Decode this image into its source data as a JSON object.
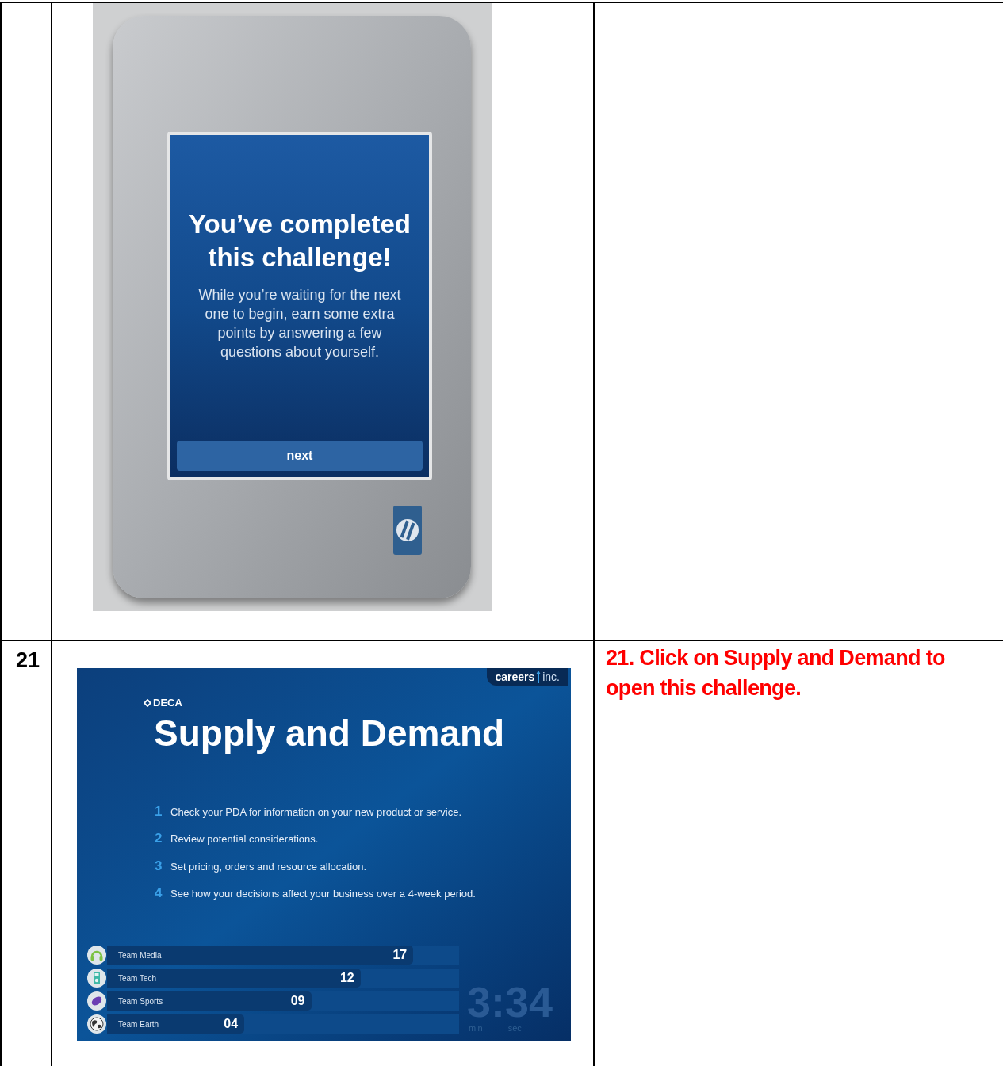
{
  "table": {
    "rows": [
      {
        "pda_screen": {
          "title": "You’ve completed this challenge!",
          "message": "While you’re waiting for the next one to begin, earn some extra points by answering a few questions about yourself.",
          "button": "next"
        }
      },
      {
        "step": "21",
        "challenge_screen": {
          "brand": [
            "careers",
            "inc."
          ],
          "org": "DECA",
          "title": "Supply and Demand",
          "steps": [
            {
              "number": "1",
              "text": "Check your PDA for information on your new product or service."
            },
            {
              "number": "2",
              "text": "Review potential considerations."
            },
            {
              "number": "3",
              "text": "Set pricing, orders and resource allocation."
            },
            {
              "number": "4",
              "text": "See how your decisions affect your business over a 4-week period."
            }
          ],
          "teams": [
            {
              "name": "Team Media",
              "score": "17",
              "level": 0.87
            },
            {
              "name": "Team Tech",
              "score": "12",
              "level": 0.72
            },
            {
              "name": "Team Sports",
              "score": "09",
              "level": 0.58
            },
            {
              "name": "Team Earth",
              "score": "04",
              "level": 0.39
            }
          ],
          "timer": {
            "value": "3:34",
            "min_label": "min",
            "sec_label": "sec"
          }
        },
        "instruction": "21. Click on Supply and Demand to open this challenge."
      }
    ]
  }
}
